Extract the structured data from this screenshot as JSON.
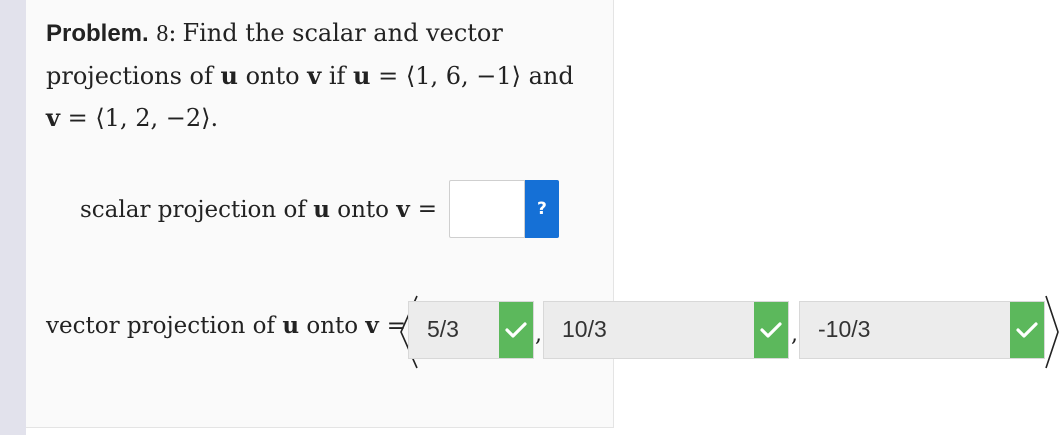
{
  "problem": {
    "label": "Problem.",
    "number": "8",
    "colon": ":",
    "line1_text": "Find the scalar and vector",
    "line2_a": "projections of ",
    "line2_u": "u",
    "line2_b": " onto ",
    "line2_v": "v",
    "line2_c": " if ",
    "line2_u2": "u",
    "line2_d": " = ⟨1, 6, −1⟩ and",
    "line3_v": "v",
    "line3_d": " = ⟨1, 2, −2⟩."
  },
  "scalar": {
    "label_a": "scalar projection of ",
    "label_u": "u",
    "label_b": " onto ",
    "label_v": "v",
    "equals": "=",
    "answer_value": "",
    "help_label": "?"
  },
  "vector": {
    "label_a": "vector projection of ",
    "label_u": "u",
    "label_b": " onto ",
    "label_v": "v",
    "equals": "=",
    "components": [
      "5/3",
      "10/3",
      "-10/3"
    ],
    "separator": ",",
    "status": "correct",
    "check_color": "#5cb85c"
  },
  "colors": {
    "help_button": "#1570d6",
    "side_strip": "#e2e2ec"
  },
  "icons": {
    "help": "question-mark-icon",
    "correct": "checkmark-icon"
  }
}
